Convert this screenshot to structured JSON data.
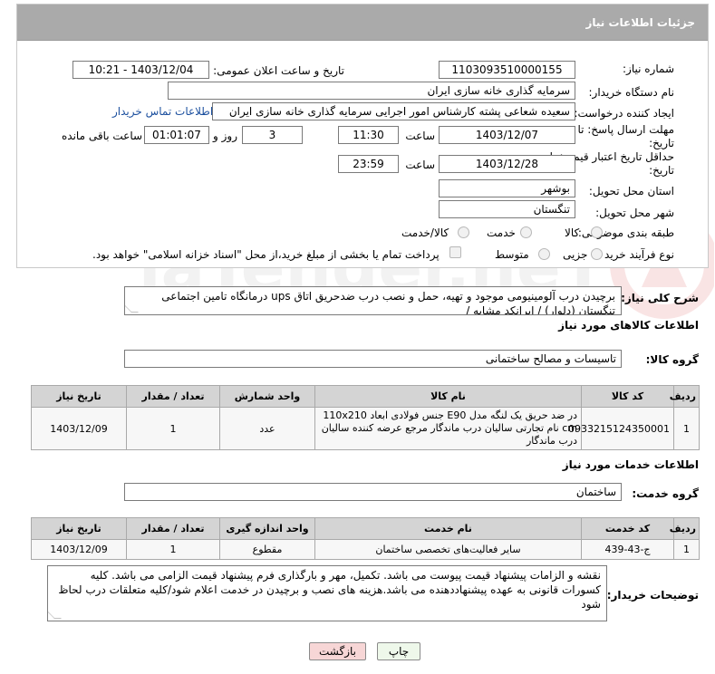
{
  "panel": {
    "title": "جزئیات اطلاعات نیاز"
  },
  "fields": {
    "need_number_label": "شماره نیاز:",
    "need_number": "1103093510000155",
    "announce_label": "تاریخ و ساعت اعلان عمومی:",
    "announce_value": "1403/12/04 - 10:21",
    "buyer_org_label": "نام دستگاه خریدار:",
    "buyer_org": "سرمایه گذاری خانه سازی ایران",
    "requester_label": "ایجاد کننده درخواست:",
    "requester": "سعیده شعاعی پشته کارشناس امور اجرایی سرمایه گذاری خانه سازی ایران",
    "contact_link": "اطلاعات تماس خریدار",
    "deadline_label_1": "مهلت ارسال پاسخ: تا",
    "deadline_label_2": "تاریخ:",
    "deadline_date": "1403/12/07",
    "time_label": "ساعت",
    "deadline_time": "11:30",
    "days_value": "3",
    "days_label": "روز و",
    "remaining_time": "01:01:07",
    "remaining_label": "ساعت باقی مانده",
    "validity_label_1": "حداقل تاریخ اعتبار قیمت: تا",
    "validity_label_2": "تاریخ:",
    "validity_date": "1403/12/28",
    "validity_time_label": "ساعت",
    "validity_time": "23:59",
    "province_label": "استان محل تحویل:",
    "province": "بوشهر",
    "city_label": "شهر محل تحویل:",
    "city": "تنگستان",
    "category_label": "طبقه بندی موضوعی:",
    "category_options": [
      "کالا",
      "خدمت",
      "کالا/خدمت"
    ],
    "process_label": "نوع فرآیند خرید :",
    "process_options": [
      "جزیی",
      "متوسط"
    ],
    "payment_note": "پرداخت تمام یا بخشی از مبلغ خرید،از محل \"اسناد خزانه اسلامی\" خواهد بود."
  },
  "description": {
    "label": "شرح کلی نیاز:",
    "text": "برچیدن درب آلومینیومی موجود و تهیه، حمل و نصب درب ضدحریق اتاق ups درمانگاه تامین اجتماعی تنگستان (دلوار) / ایرانکد مشابه /"
  },
  "goods": {
    "section_title": "اطلاعات کالاهای مورد نیاز",
    "group_label": "گروه کالا:",
    "group_value": "تاسیسات و مصالح ساختمانی",
    "headers": [
      "ردیف",
      "کد کالا",
      "نام کالا",
      "واحد شمارش",
      "تعداد / مقدار",
      "تاریخ نیاز"
    ],
    "rows": [
      {
        "row": "1",
        "code": "0933215124350001",
        "name": "در ضد حریق یک لنگه مدل E90 جنس فولادی ابعاد 110x210 cm نام تجارتی سالیان درب ماندگار مرجع عرضه کننده سالیان درب ماندگار",
        "unit": "عدد",
        "qty": "1",
        "date": "1403/12/09"
      }
    ]
  },
  "services": {
    "section_title": "اطلاعات خدمات مورد نیاز",
    "group_label": "گروه خدمت:",
    "group_value": "ساختمان",
    "headers": [
      "ردیف",
      "کد خدمت",
      "نام خدمت",
      "واحد اندازه گیری",
      "تعداد / مقدار",
      "تاریخ نیاز"
    ],
    "rows": [
      {
        "row": "1",
        "code": "ج-43-439",
        "name": "سایر فعالیت‌های تخصصی ساختمان",
        "unit": "مقطوع",
        "qty": "1",
        "date": "1403/12/09"
      }
    ]
  },
  "buyer_notes": {
    "label": "توضیحات خریدار:",
    "text": "نقشه و الزامات پیشنهاد قیمت پیوست می باشد. تکمیل، مهر و بارگذاری فرم پیشنهاد قیمت الزامی می باشد. کلیه کسورات قانونی به عهده پیشنهاددهنده می باشد.هزینه های نصب و برچیدن در خدمت اعلام شود/کلیه متعلقات درب لحاظ شود"
  },
  "buttons": {
    "print": "چاپ",
    "back": "بازگشت"
  },
  "colors": {
    "header_bg": "#aaaaaa",
    "link": "#1b4f9e",
    "back_button_bg": "#f7d6d6",
    "print_button_bg": "#eef8ea"
  }
}
